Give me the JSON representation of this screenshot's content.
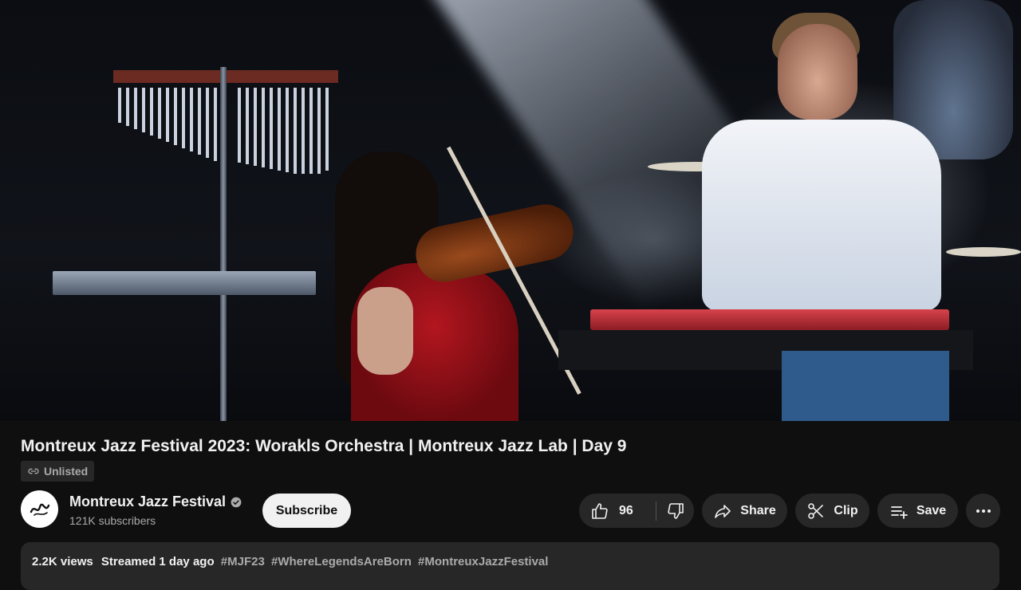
{
  "video": {
    "title": "Montreux Jazz Festival 2023: Worakls Orchestra | Montreux Jazz Lab | Day 9",
    "visibility": "Unlisted"
  },
  "channel": {
    "name": "Montreux Jazz Festival",
    "subscribers": "121K subscribers",
    "verified": true,
    "avatar_icon": "montreux-logo-icon"
  },
  "actions": {
    "subscribe_label": "Subscribe",
    "like_count": "96",
    "share_label": "Share",
    "clip_label": "Clip",
    "save_label": "Save"
  },
  "description": {
    "views": "2.2K views",
    "streamed": "Streamed 1 day ago",
    "hashtags": [
      "#MJF23",
      "#WhereLegendsAreBorn",
      "#MontreuxJazzFestival"
    ]
  },
  "colors": {
    "background": "#0f0f0f",
    "pill": "#272727",
    "text_primary": "#f1f1f1",
    "text_secondary": "#aaaaaa",
    "subscribe_bg": "#f1f1f1"
  }
}
